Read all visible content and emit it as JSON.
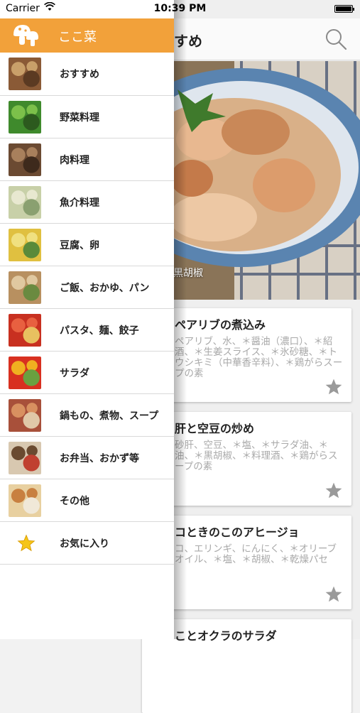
{
  "status_bar": {
    "carrier": "Carrier",
    "time": "10:39 PM",
    "battery_level": 1.0
  },
  "drawer": {
    "title": "ここ菜",
    "header_color": "#f2a13a",
    "items": [
      {
        "label": "おすすめ",
        "thumb": [
          "#8a5a36",
          "#c9a06a",
          "#5b3a22"
        ]
      },
      {
        "label": "野菜料理",
        "thumb": [
          "#3f8a2c",
          "#7cc04a",
          "#2c5a1e"
        ]
      },
      {
        "label": "肉料理",
        "thumb": [
          "#6b4a32",
          "#a8805c",
          "#3e2a1c"
        ]
      },
      {
        "label": "魚介料理",
        "thumb": [
          "#c8d0a8",
          "#e8e8d0",
          "#8aa070"
        ]
      },
      {
        "label": "豆腐、卵",
        "thumb": [
          "#e0c040",
          "#f0e080",
          "#5a8a3a"
        ]
      },
      {
        "label": "ご飯、おかゆ、パン",
        "thumb": [
          "#b89060",
          "#e0c8a0",
          "#6a8a40"
        ]
      },
      {
        "label": "パスタ、麺、餃子",
        "thumb": [
          "#c83020",
          "#e86040",
          "#e8c060"
        ]
      },
      {
        "label": "サラダ",
        "thumb": [
          "#d83020",
          "#f0b020",
          "#6aa040"
        ]
      },
      {
        "label": "鍋もの、煮物、スープ",
        "thumb": [
          "#a8503a",
          "#d89060",
          "#e0c8a8"
        ]
      },
      {
        "label": "お弁当、おかず等",
        "thumb": [
          "#d8c8b0",
          "#6a4a30",
          "#c04030"
        ]
      },
      {
        "label": "その他",
        "thumb": [
          "#e8d0a0",
          "#c88040",
          "#f0e8d8"
        ]
      }
    ],
    "favorites": {
      "label": "お気に入り",
      "icon": "star-icon",
      "icon_color": "#f5c518"
    }
  },
  "main": {
    "title_partial": "すすめ",
    "search_icon": "search-icon",
    "hero": {
      "caption": "＊黒胡椒"
    },
    "cards": [
      {
        "title": "ペアリブの煮込み",
        "ingredients": "ペアリブ、水、＊醤油（濃口）、＊紹酒、＊生姜スライス、＊氷砂糖、＊トウシキミ（中華香辛料）、＊鶏がらスープの素"
      },
      {
        "title": "肝と空豆の炒め",
        "ingredients": "砂肝、空豆、＊塩、＊サラダ油、＊油、＊黒胡椒、＊料理酒、＊鶏がらスープの素"
      },
      {
        "title": "コときのこのアヒージョ",
        "ingredients": "コ、エリンギ、にんにく、＊オリーブオイル、＊塩、＊胡椒、＊乾燥パセ"
      },
      {
        "title": "ことオクラのサラダ",
        "ingredients": ""
      }
    ]
  }
}
